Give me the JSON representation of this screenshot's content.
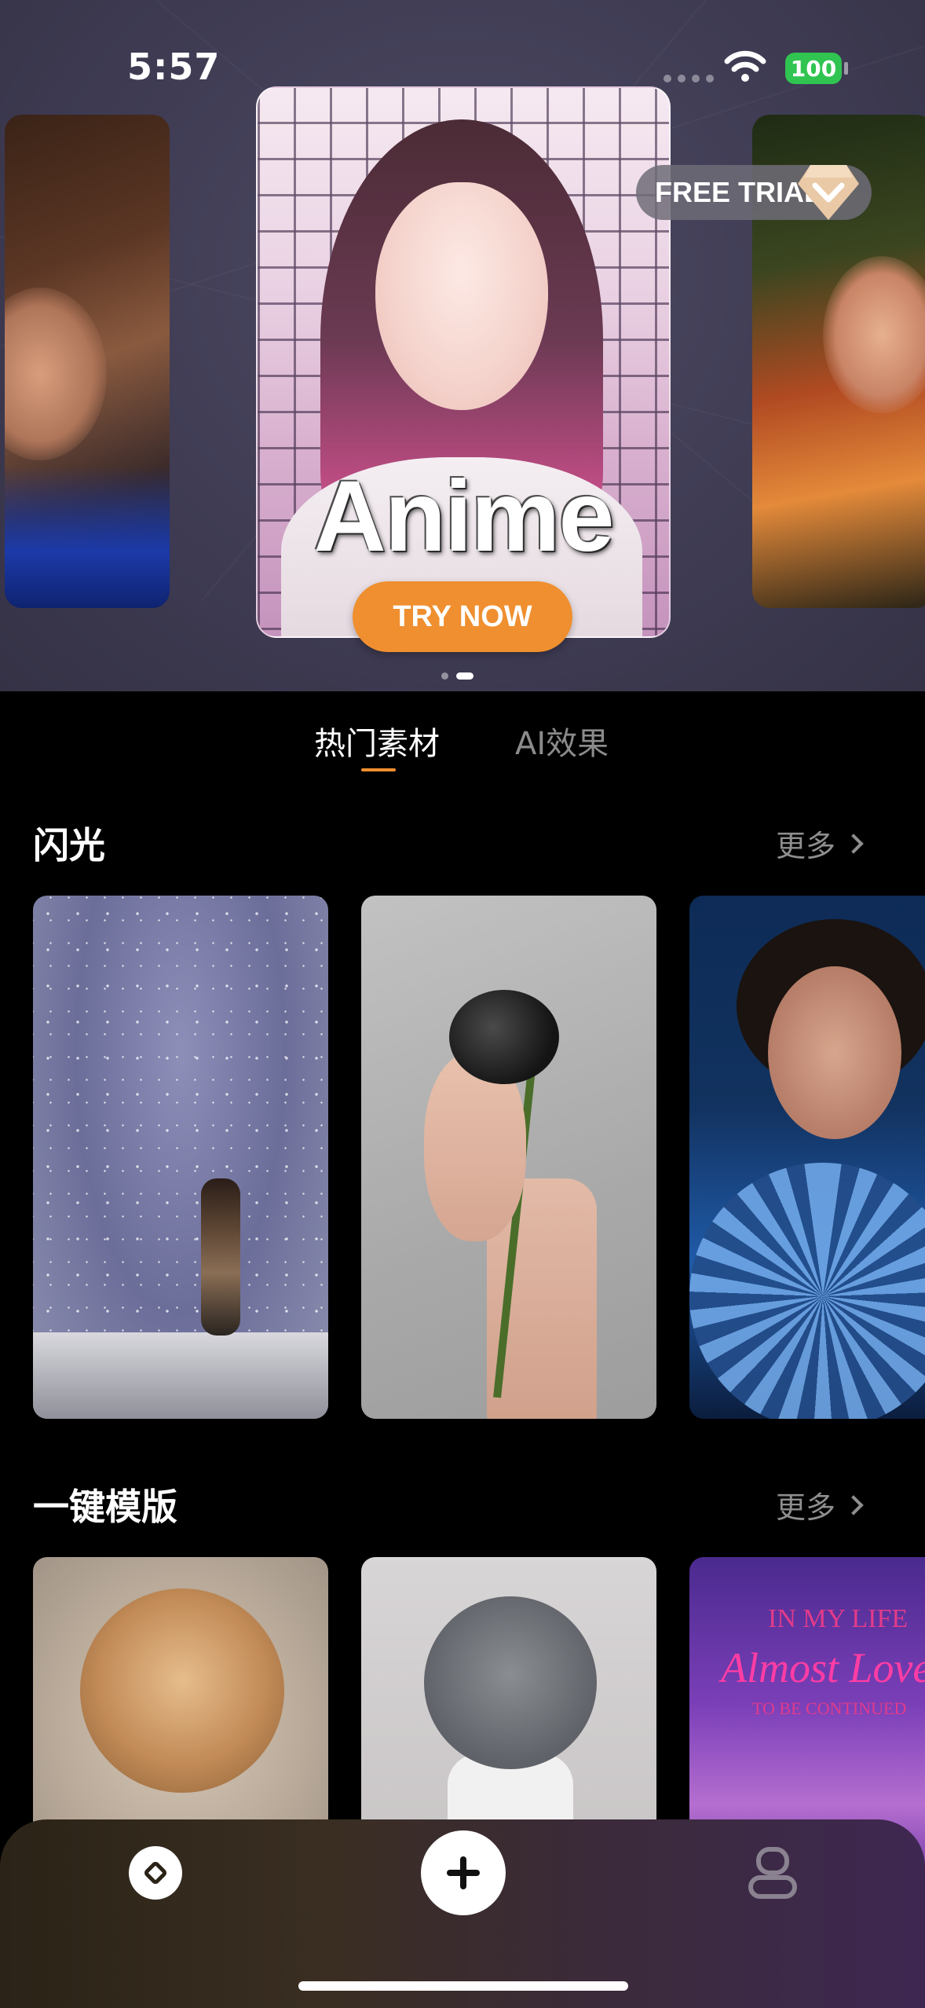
{
  "status_bar": {
    "time": "5:57",
    "battery": "100"
  },
  "banner": {
    "title": "Anime",
    "cta": "TRY NOW",
    "badge": "FREE TRIAL",
    "pager": {
      "count": 2,
      "active_index": 1
    }
  },
  "tabs": [
    {
      "label": "热门素材",
      "active": true
    },
    {
      "label": "AI效果",
      "active": false
    }
  ],
  "sections": [
    {
      "title": "闪光",
      "more": "更多"
    },
    {
      "title": "一键模版",
      "more": "更多"
    }
  ],
  "template_card_text": {
    "line1": "IN MY LIFE",
    "line2": "Almost Love",
    "line3": "TO BE CONTINUED"
  },
  "bottom_nav": {
    "items": [
      {
        "icon": "compass-icon"
      },
      {
        "icon": "plus-icon"
      },
      {
        "icon": "profile-icon"
      }
    ]
  },
  "colors": {
    "accent": "#ef8f2f",
    "battery": "#30c450"
  }
}
